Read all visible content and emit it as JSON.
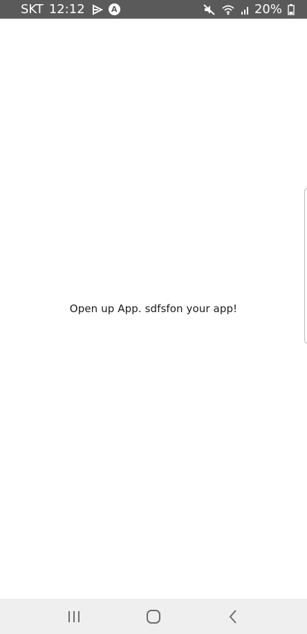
{
  "status_bar": {
    "carrier": "SKT",
    "time": "12:12",
    "battery": "20%",
    "icons_left": [
      "play-store-notification-icon",
      "a-circle-notification-icon"
    ],
    "icons_right": [
      "mute-icon",
      "wifi-icon",
      "cellular-signal-icon",
      "battery-icon"
    ],
    "a_badge": "A",
    "background": "#5a5a5a"
  },
  "main": {
    "message": "Open up App. sdfsfon your app!"
  },
  "nav_bar": {
    "buttons": [
      "recent-apps",
      "home",
      "back"
    ],
    "background": "#efefef"
  }
}
